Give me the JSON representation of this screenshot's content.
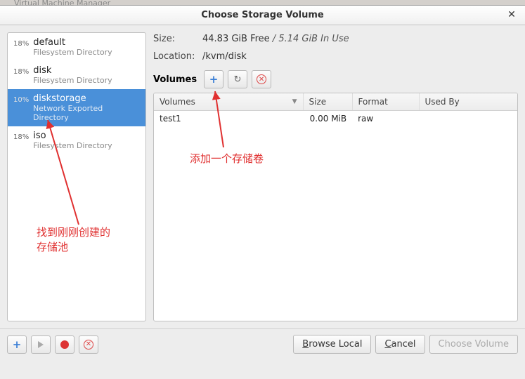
{
  "window": {
    "back_title_fragment": "Virtual Machine Manager",
    "title": "Choose Storage Volume"
  },
  "sidebar": {
    "pools": [
      {
        "pct": "18%",
        "name": "default",
        "sub": "Filesystem Directory"
      },
      {
        "pct": "18%",
        "name": "disk",
        "sub": "Filesystem Directory"
      },
      {
        "pct": "10%",
        "name": "diskstorage",
        "sub": "Network Exported Directory"
      },
      {
        "pct": "18%",
        "name": "iso",
        "sub": "Filesystem Directory"
      }
    ],
    "selected_index": 2
  },
  "info": {
    "size_label": "Size:",
    "free": "44.83 GiB Free",
    "sep": " / ",
    "inuse": "5.14 GiB In Use",
    "location_label": "Location:",
    "location": "/kvm/disk"
  },
  "toolbar": {
    "volumes_label": "Volumes",
    "add_icon": "plus-icon",
    "refresh_icon": "refresh-icon",
    "delete_icon": "delete-icon"
  },
  "table": {
    "headers": {
      "volumes": "Volumes",
      "size": "Size",
      "format": "Format",
      "used_by": "Used By"
    },
    "rows": [
      {
        "name": "test1",
        "size": "0.00 MiB",
        "format": "raw",
        "used_by": ""
      }
    ]
  },
  "bottom": {
    "browse_local": "Browse Local",
    "cancel": "Cancel",
    "choose_volume": "Choose Volume"
  },
  "annotations": {
    "add_hint": "添加一个存储卷",
    "pool_hint": "找到刚刚创建的\n存储池"
  }
}
